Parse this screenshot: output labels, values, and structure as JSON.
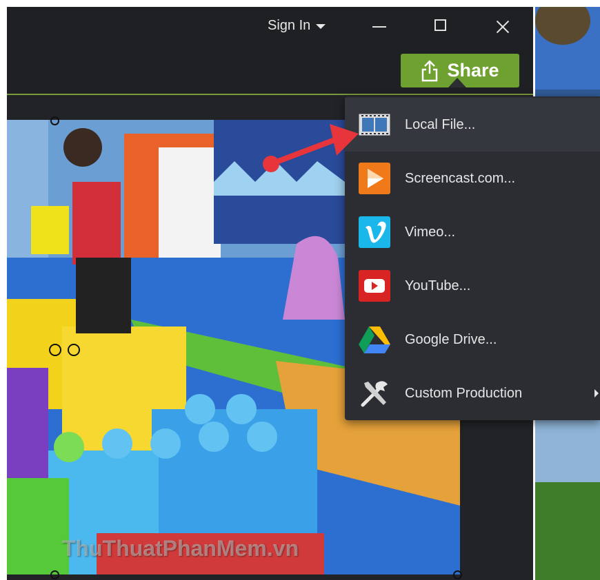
{
  "titlebar": {
    "signin_label": "Sign In"
  },
  "toolbar": {
    "share_label": "Share"
  },
  "share_menu": {
    "items": [
      {
        "label": "Local File...",
        "icon": "film-strip-icon"
      },
      {
        "label": "Screencast.com...",
        "icon": "screencast-icon"
      },
      {
        "label": "Vimeo...",
        "icon": "vimeo-icon"
      },
      {
        "label": "YouTube...",
        "icon": "youtube-icon"
      },
      {
        "label": "Google Drive...",
        "icon": "google-drive-icon"
      },
      {
        "label": "Custom Production",
        "icon": "tools-icon"
      }
    ]
  },
  "canvas": {
    "watermark": "ThuThuatPhanMem.vn"
  },
  "colors": {
    "share_green": "#6ea12f",
    "menu_bg": "#2b2d33",
    "highlight": "#34373e",
    "annotation_red": "#e8353b"
  }
}
